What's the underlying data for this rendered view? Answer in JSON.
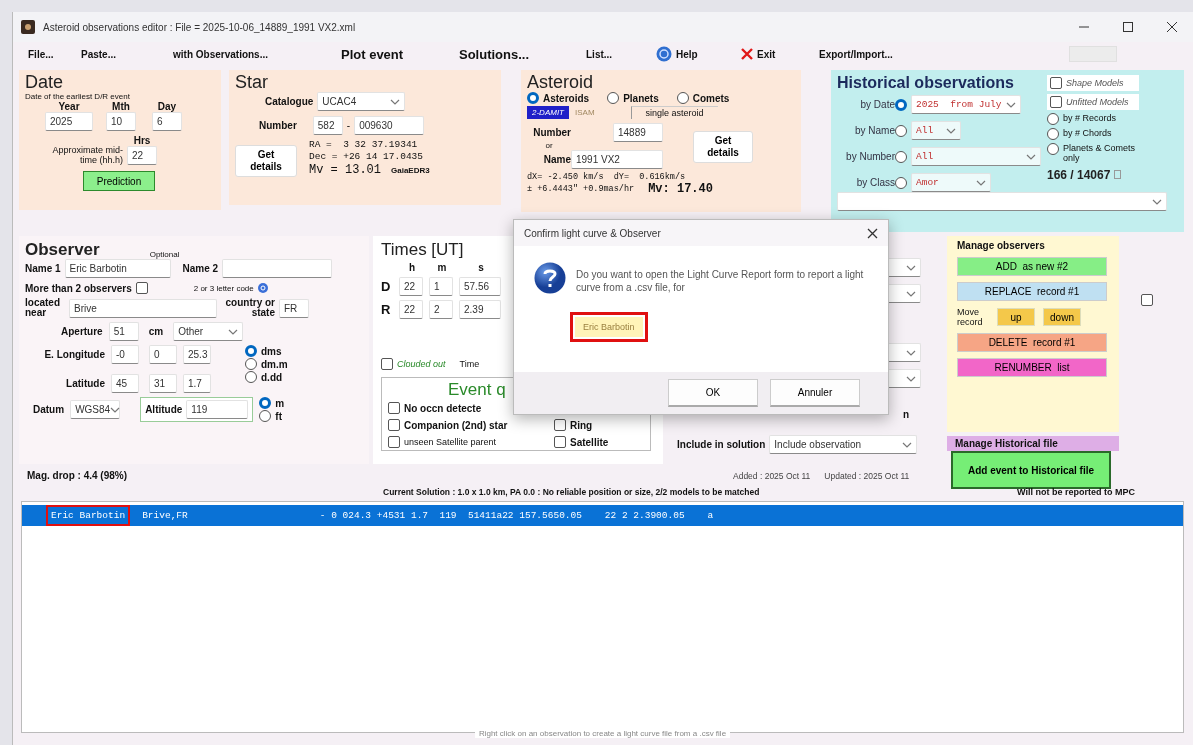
{
  "window": {
    "title": "Asteroid observations editor : File = 2025-10-06_14889_1991 VX2.xml"
  },
  "menu": [
    {
      "label": "File...",
      "kind": "plain"
    },
    {
      "label": "Paste...",
      "kind": "plain"
    },
    {
      "label": "with Observations...",
      "kind": "plain"
    },
    {
      "label": "Plot event",
      "kind": "bold"
    },
    {
      "label": "Solutions...",
      "kind": "bold"
    },
    {
      "label": "List...",
      "kind": "plain"
    },
    {
      "label": "Help",
      "kind": "help"
    },
    {
      "label": "Exit",
      "kind": "exit"
    },
    {
      "label": "Export/Import...",
      "kind": "plain"
    }
  ],
  "date": {
    "title": "Date",
    "note": "Date of the earliest D/R event",
    "fields": [
      {
        "label": "Year",
        "value": "2025"
      },
      {
        "label": "Mth",
        "value": "10"
      },
      {
        "label": "Day",
        "value": "6"
      }
    ],
    "midtime_label": "Approximate mid-time (hh.h)",
    "hours_label": "Hrs",
    "hours": "22",
    "button": "Prediction"
  },
  "star": {
    "title": "Star",
    "catalogue_label": "Catalogue",
    "catalogue": "UCAC4",
    "number_label": "Number",
    "zone": "582",
    "separator": "-",
    "number": "009630",
    "button": "Get details",
    "lines": [
      "RA =  3 32 37.19341",
      "Dec = +26 14 17.0435"
    ],
    "magnitude": "Mv = 13.01",
    "source": "GaiaEDR3"
  },
  "asteroid": {
    "title": "Asteroid",
    "types": [
      {
        "label": "Asteroids",
        "selected": true
      },
      {
        "label": "Planets",
        "selected": false
      },
      {
        "label": "Comets",
        "selected": false
      }
    ],
    "models": [
      "2-DAMIT",
      "ISAM"
    ],
    "mode": "single asteroid",
    "number_label": "Number",
    "number": "14889",
    "or": "or",
    "name_label": "Name",
    "name": "1991 VX2",
    "button": "Get details",
    "lines": [
      "dX= -2.450 km/s  dY=  0.616km/s",
      "± +6.4443\" +0.9mas/hr"
    ],
    "magnitude": "Mv: 17.40"
  },
  "historical": {
    "title": "Historical observations",
    "filters": [
      {
        "label": "by Date",
        "selected": true,
        "value": "2025  from July"
      },
      {
        "label": "by Name",
        "selected": false,
        "value": "All"
      },
      {
        "label": "by Number",
        "selected": false,
        "value": "All"
      },
      {
        "label": "by Class",
        "selected": false,
        "value": "Amor"
      }
    ],
    "model_options": [
      {
        "label": "Shape Models",
        "checked": false
      },
      {
        "label": "Unfitted Models",
        "checked": false
      }
    ],
    "sort_options": [
      {
        "label": "by # Records",
        "selected": false
      },
      {
        "label": "by # Chords",
        "selected": false
      },
      {
        "label": "Planets & Comets only",
        "selected": false
      }
    ],
    "count": "166 / 14067"
  },
  "observer": {
    "title": "Observer",
    "name1_label": "Name 1",
    "name1": "Eric Barbotin",
    "optional": "Optional",
    "name2_label": "Name 2",
    "more_label": "More than 2 observers",
    "more_checked": false,
    "code_hint": "2 or 3 letter code",
    "location_label": "located near",
    "location": "Brive",
    "country_label": "country or state",
    "country": "FR",
    "aperture_label": "Aperture",
    "aperture": "51",
    "aperture_unit": "cm",
    "telescope": "Other",
    "longitude_label": "E. Longitude",
    "longitude": [
      "-0",
      "0",
      "25.3"
    ],
    "latitude_label": "Latitude",
    "latitude": [
      "45",
      "31",
      "1.7"
    ],
    "formats": [
      {
        "label": "dms",
        "selected": true
      },
      {
        "label": "dm.m",
        "selected": false
      },
      {
        "label": "d.dd",
        "selected": false
      }
    ],
    "datum_label": "Datum",
    "datum": "WGS84",
    "altitude_label": "Altitude",
    "altitude": "119",
    "altitude_units": [
      {
        "label": "m",
        "selected": true
      },
      {
        "label": "ft",
        "selected": false
      }
    ]
  },
  "times": {
    "title": "Times [UT]",
    "headers": [
      "h",
      "m",
      "s"
    ],
    "events": [
      {
        "label": "D",
        "values": [
          "22",
          "1",
          "57.56"
        ]
      },
      {
        "label": "R",
        "values": [
          "22",
          "2",
          "2.39"
        ]
      }
    ],
    "clouded_label": "Clouded out",
    "clouded": false,
    "time_label": "Time",
    "quality_title": "Event q",
    "flags": [
      {
        "label": "No occn detecte",
        "checked": false
      },
      {
        "label": "Companion (2nd) star",
        "checked": false
      },
      {
        "label": "Ring",
        "checked": false
      },
      {
        "label": "unseen Satellite parent",
        "checked": false
      },
      {
        "label": "Satellite",
        "checked": false
      }
    ]
  },
  "solution": {
    "label_tail": "n",
    "include_label": "Include in solution",
    "include": "Include observation"
  },
  "manage": {
    "title": "Manage observers",
    "buttons": [
      {
        "label": "ADD  as new #2",
        "kind": "add"
      },
      {
        "label": "REPLACE  record #1",
        "kind": "replace"
      },
      {
        "label": "Move record",
        "kind": "move",
        "up": "up",
        "down": "down"
      },
      {
        "label": "DELETE  record #1",
        "kind": "delete"
      },
      {
        "label": "RENUMBER  list",
        "kind": "renumber"
      }
    ],
    "historical_title": "Manage Historical file",
    "historical_button": "Add event to Historical file"
  },
  "side_option": {
    "checked": false
  },
  "summary": {
    "mag_drop": "Mag. drop : 4.4 (98%)",
    "added": "Added : 2025 Oct 11",
    "updated": "Updated : 2025 Oct 11",
    "solution": "Current Solution : 1.0 x 1.0 km, PA 0.0 : No reliable position or size, 2/2 models to be matched",
    "mpc": "Will not be reported to MPC"
  },
  "observations": {
    "rows": [
      {
        "name": "Eric Barbotin",
        "place": "Brive,FR",
        "data": "- 0 024.3 +4531 1.7  119  51411a22 157.5650.05    22 2 2.3900.05    a",
        "selected": true,
        "highlighted": true
      }
    ],
    "hint": "Right click on an observation to create a light curve file from a .csv file"
  },
  "dialog": {
    "title": "Confirm light curve & Observer",
    "message": "Do you want to open the Light Curve Report form to report a light curve from a .csv file, for",
    "observer": "Eric Barbotin",
    "highlighted": true,
    "buttons": [
      {
        "label": "OK"
      },
      {
        "label": "Annuler"
      }
    ]
  }
}
